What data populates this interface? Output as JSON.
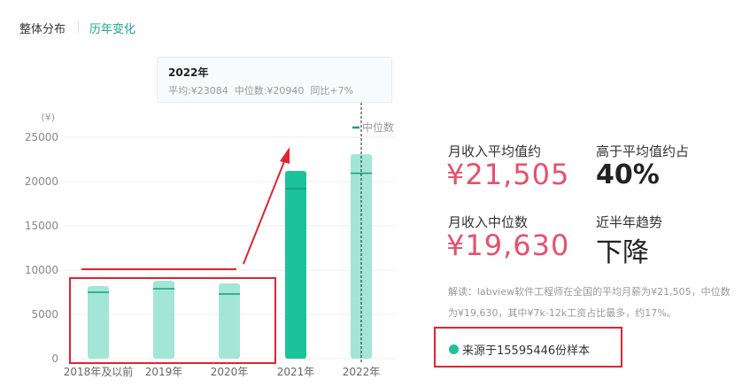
{
  "tabs": [
    {
      "label": "整体分布",
      "active": false
    },
    {
      "label": "历年变化",
      "active": true
    }
  ],
  "tooltip": {
    "title": "2022年",
    "detail": "平均:¥23084  中位数:¥20940  同比+7%"
  },
  "chart_data": {
    "type": "bar",
    "ylabel": "(¥)",
    "ylim": [
      0,
      25000
    ],
    "yticks": [
      "0",
      "5000",
      "10000",
      "15000",
      "20000",
      "25000"
    ],
    "categories": [
      "2018年及以前",
      "2019年",
      "2020年",
      "2021年",
      "2022年"
    ],
    "series": [
      {
        "name": "平均",
        "values": [
          8200,
          8800,
          8500,
          21200,
          23084
        ]
      },
      {
        "name": "中位数",
        "values": [
          7500,
          7900,
          7300,
          19200,
          20940
        ]
      }
    ],
    "legend": "中位数",
    "highlight_index": 3,
    "colors": {
      "light": "#a3e6d6",
      "dark": "#1cc29a",
      "median": "#179e7e"
    }
  },
  "stats": {
    "avg_label": "月收入平均值约",
    "avg_value": "¥21,505",
    "above_label": "高于平均值约占",
    "above_value": "40%",
    "median_label": "月收入中位数",
    "median_value": "¥19,630",
    "trend_label": "近半年趋势",
    "trend_value": "下降"
  },
  "note": "解读：labview软件工程师在全国的平均月薪为¥21,505，中位数为¥19,630，其中¥7k-12k工资占比最多，约17%。",
  "source": "来源于15595446份样本",
  "annotation_color": "#e02530"
}
